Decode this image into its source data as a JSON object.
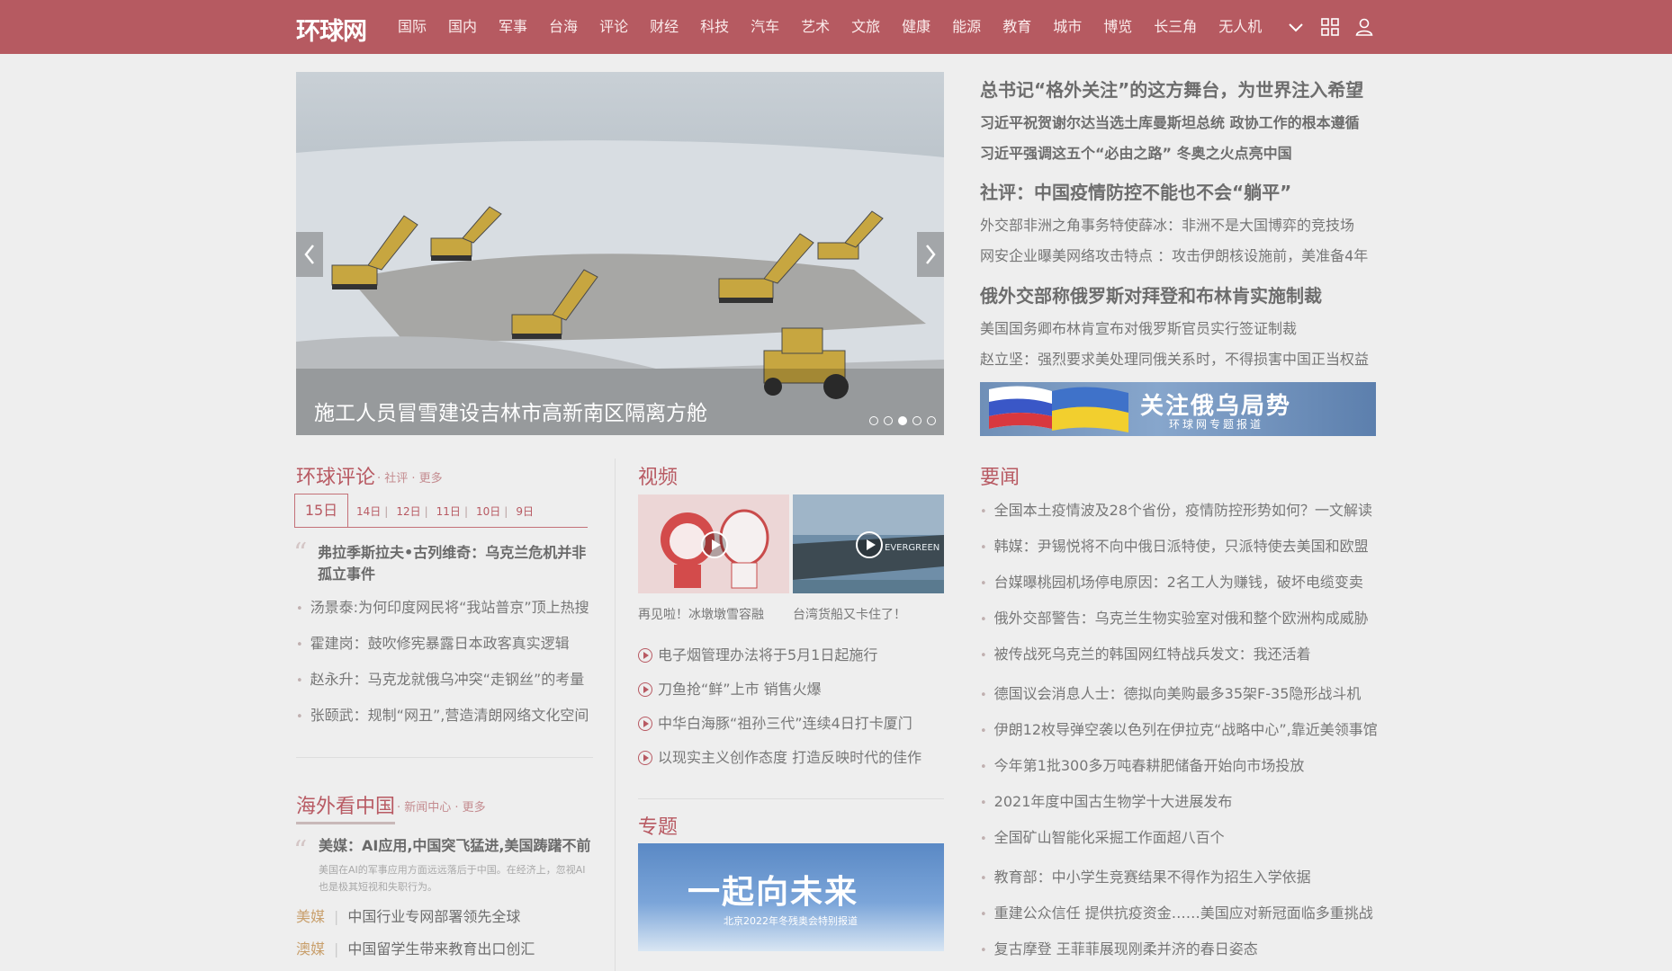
{
  "header": {
    "logo": "环球网",
    "nav": [
      "国际",
      "国内",
      "军事",
      "台海",
      "评论",
      "财经",
      "科技",
      "汽车",
      "艺术",
      "文旅",
      "健康",
      "能源",
      "教育",
      "城市",
      "博览",
      "长三角",
      "无人机"
    ],
    "icons": [
      "chevron-down-icon",
      "grid-icon",
      "user-icon"
    ]
  },
  "hero": {
    "caption": "施工人员冒雪建设吉林市高新南区隔离方舱",
    "active_slide": 3,
    "slide_count": 5
  },
  "headlines": [
    {
      "title": "总书记“格外关注”的这方舞台，为世界注入希望",
      "subs": [
        "习近平祝贺谢尔达当选土库曼斯坦总统 政协工作的根本遵循",
        "习近平强调这五个“必由之路” 冬奥之火点亮中国"
      ]
    },
    {
      "title": "社评：中国疫情防控不能也不会“躺平”",
      "subs": [
        "外交部非洲之角事务特使薛冰：非洲不是大国博弈的竞技场",
        "网安企业曝美网络攻击特点 ：攻击伊朗核设施前，美准备4年"
      ]
    },
    {
      "title": "俄外交部称俄罗斯对拜登和布林肯实施制裁",
      "subs": [
        "美国国务卿布林肯宣布对俄罗斯官员实行签证制裁",
        "赵立坚：强烈要求美处理同俄关系时，不得损害中国正当权益"
      ]
    }
  ],
  "banner": {
    "title": "关注俄乌局势",
    "subtitle": "环球网专题报道"
  },
  "commentary": {
    "title": "环球评论",
    "links": "· 社评 · 更多",
    "tabs": [
      "15日",
      "14日",
      "12日",
      "11日",
      "10日",
      "9日"
    ],
    "featured": "弗拉季斯拉夫•古列维奇：乌克兰危机并非孤立事件",
    "items": [
      "汤景泰:为何印度网民将“我站普京”顶上热搜",
      "霍建岗：鼓吹修宪暴露日本政客真实逻辑",
      "赵永升：马克龙就俄乌冲突“走钢丝”的考量",
      "张颐武：规制“网丑”,营造清朗网络文化空间"
    ]
  },
  "overseas": {
    "title": "海外看中国",
    "links": "· 新闻中心 · 更多",
    "featured": "美媒：AI应用,中国突飞猛进,美国踌躇不前",
    "summary": "美国在AI的军事应用方面远远落后于中国。在经济上，忽视AI也是极其短视和失职行为。",
    "rows": [
      {
        "source": "美媒",
        "text": "中国行业专网部署领先全球"
      },
      {
        "source": "澳媒",
        "text": "中国留学生带来教育出口创汇"
      }
    ]
  },
  "video": {
    "title": "视频",
    "thumbs": [
      {
        "caption": "再见啦！冰墩墩雪容融"
      },
      {
        "caption": "台湾货船又卡住了！",
        "ship_text": "EVERGREEN"
      }
    ],
    "items": [
      "电子烟管理办法将于5月1日起施行",
      "刀鱼抢“鲜”上市 销售火爆",
      "中华白海豚“祖孙三代”连续4日打卡厦门",
      "以现实主义创作态度 打造反映时代的佳作"
    ]
  },
  "special": {
    "title": "专题",
    "banner_title": "一起向未来",
    "banner_sub": "北京2022年冬残奥会特别报道"
  },
  "news": {
    "title": "要闻",
    "group1": [
      "全国本土疫情波及28个省份，疫情防控形势如何？一文解读",
      "韩媒：尹锡悦将不向中俄日派特使，只派特使去美国和欧盟",
      "台媒曝桃园机场停电原因：2名工人为赚钱，破坏电缆变卖",
      "俄外交部警告：乌克兰生物实验室对俄和整个欧洲构成威胁",
      "被传战死乌克兰的韩国网红特战兵发文：我还活着"
    ],
    "group2": [
      "德国议会消息人士：德拟向美购最多35架F-35隐形战斗机",
      "伊朗12枚导弹空袭以色列在伊拉克“战略中心”,靠近美领事馆",
      "今年第1批300多万吨春耕肥储备开始向市场投放",
      "2021年度中国古生物学十大进展发布",
      "全国矿山智能化采掘工作面超八百个"
    ],
    "group3": [
      "教育部：中小学生竞赛结果不得作为招生入学依据",
      "重建公众信任 提供抗疫资金……美国应对新冠面临多重挑战",
      "复古摩登 王菲菲展现刚柔并济的春日姿态"
    ]
  },
  "colors": {
    "brand": "#b65a61",
    "accent_text": "#b85a63",
    "source_tag": "#c9a06d"
  }
}
